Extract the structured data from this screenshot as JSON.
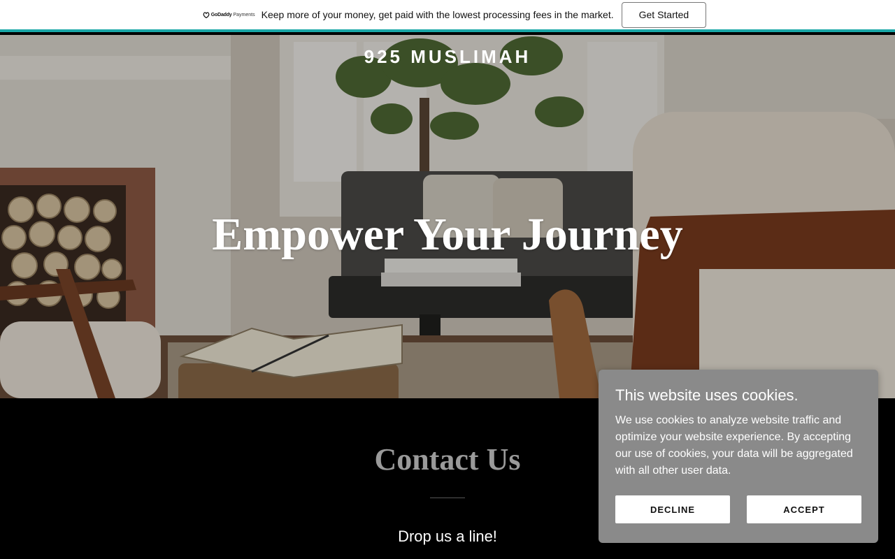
{
  "promo": {
    "logo_brand": "GoDaddy",
    "logo_sub": "Payments",
    "logo_icon": "godaddy-logo-icon",
    "message": "Keep more of your money, get paid with the lowest processing fees in the market.",
    "cta_label": "Get Started",
    "accent_color": "#1aa8a8"
  },
  "header": {
    "site_title": "925 MUSLIMAH"
  },
  "hero": {
    "headline": "Empower Your Journey"
  },
  "contact": {
    "title": "Contact Us",
    "subtitle": "Drop us a line!"
  },
  "cookie_banner": {
    "title": "This website uses cookies.",
    "body": "We use cookies to analyze website traffic and optimize your website experience. By accepting our use of cookies, your data will be aggregated with all other user data.",
    "decline_label": "DECLINE",
    "accept_label": "ACCEPT"
  }
}
